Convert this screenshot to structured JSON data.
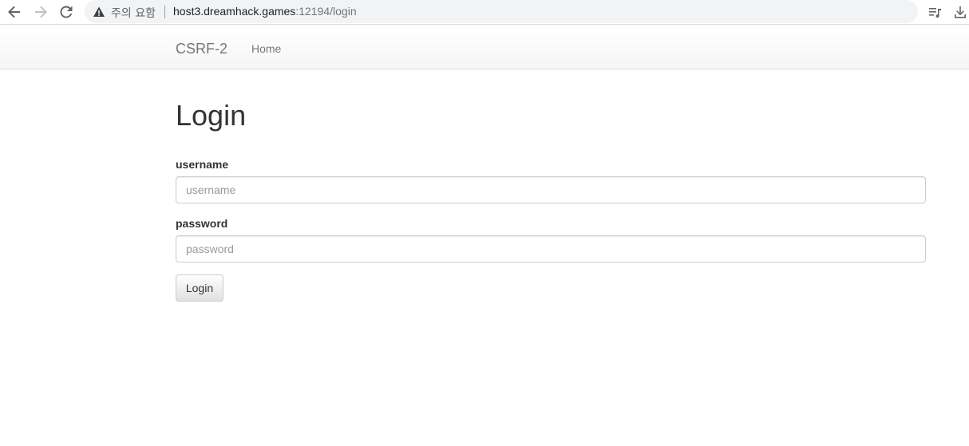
{
  "browser": {
    "back_icon": "arrow-left-icon",
    "forward_icon": "arrow-right-icon",
    "reload_icon": "reload-icon",
    "security_icon": "warning-triangle-icon",
    "security_label": "주의 요함",
    "url_host": "host3.dreamhack.games",
    "url_rest": ":12194/login",
    "reading_list_icon": "reading-list-icon",
    "download_icon": "download-icon"
  },
  "navbar": {
    "brand": "CSRF-2",
    "links": [
      "Home"
    ]
  },
  "main": {
    "title": "Login",
    "username_label": "username",
    "username_placeholder": "username",
    "username_value": "",
    "password_label": "password",
    "password_placeholder": "password",
    "password_value": "",
    "submit_label": "Login"
  },
  "colors": {
    "text": "#333333",
    "nav_text": "#777777",
    "omnibox_bg": "#f1f3f4"
  }
}
